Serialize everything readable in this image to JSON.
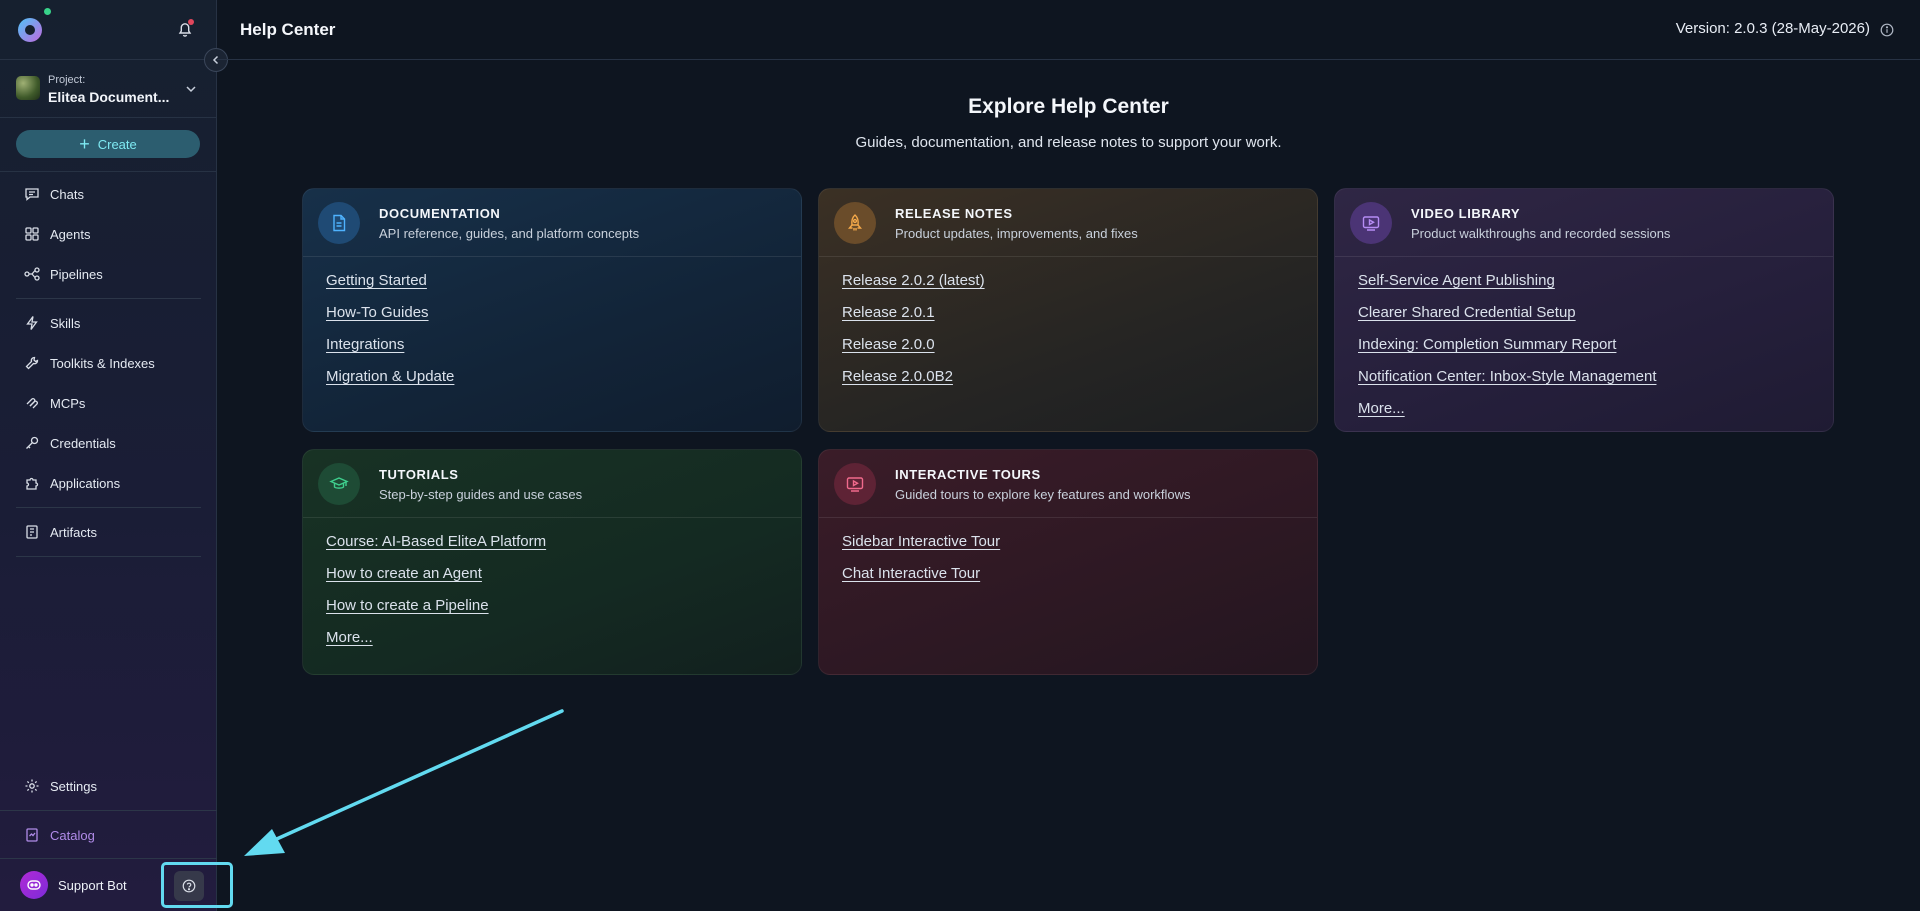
{
  "sidebar": {
    "project_label": "Project:",
    "project_name": "Elitea Document...",
    "create_label": "Create",
    "nav_groups": [
      [
        {
          "label": "Chats",
          "icon": "chat-icon"
        },
        {
          "label": "Agents",
          "icon": "agents-icon"
        },
        {
          "label": "Pipelines",
          "icon": "pipelines-icon"
        }
      ],
      [
        {
          "label": "Skills",
          "icon": "lightning-icon"
        },
        {
          "label": "Toolkits & Indexes",
          "icon": "wrench-icon"
        },
        {
          "label": "MCPs",
          "icon": "mcp-icon"
        },
        {
          "label": "Credentials",
          "icon": "key-icon"
        },
        {
          "label": "Applications",
          "icon": "puzzle-icon"
        }
      ],
      [
        {
          "label": "Artifacts",
          "icon": "artifacts-icon"
        }
      ]
    ],
    "settings_label": "Settings",
    "catalog_label": "Catalog",
    "support_label": "Support Bot"
  },
  "header": {
    "title": "Help Center",
    "version": "Version: 2.0.3 (28-May-2026)"
  },
  "hero": {
    "title": "Explore Help Center",
    "subtitle": "Guides, documentation, and release notes to support your work."
  },
  "cards": {
    "documentation": {
      "title": "DOCUMENTATION",
      "description": "API reference, guides, and platform concepts",
      "links": [
        "Getting Started",
        "How-To Guides",
        "Integrations",
        "Migration & Update"
      ]
    },
    "release_notes": {
      "title": "RELEASE NOTES",
      "description": "Product updates, improvements, and fixes",
      "links": [
        "Release 2.0.2 (latest)",
        "Release 2.0.1",
        "Release 2.0.0",
        "Release 2.0.0B2"
      ]
    },
    "video_library": {
      "title": "VIDEO LIBRARY",
      "description": "Product walkthroughs and recorded sessions",
      "links": [
        "Self-Service Agent Publishing",
        "Clearer Shared Credential Setup",
        "Indexing: Completion Summary Report",
        "Notification Center: Inbox-Style Management",
        "More..."
      ]
    },
    "tutorials": {
      "title": "TUTORIALS",
      "description": "Step-by-step guides and use cases",
      "links": [
        "Course: AI-Based EliteA Platform",
        "How to create an Agent",
        "How to create a Pipeline",
        "More..."
      ]
    },
    "interactive_tours": {
      "title": "INTERACTIVE TOURS",
      "description": "Guided tours to explore key features and workflows",
      "links": [
        "Sidebar Interactive Tour",
        "Chat Interactive Tour"
      ]
    }
  },
  "colors": {
    "accent_cyan": "#62daf0",
    "catalog_purple": "#b08be8",
    "create_text": "#7ee9f2"
  }
}
